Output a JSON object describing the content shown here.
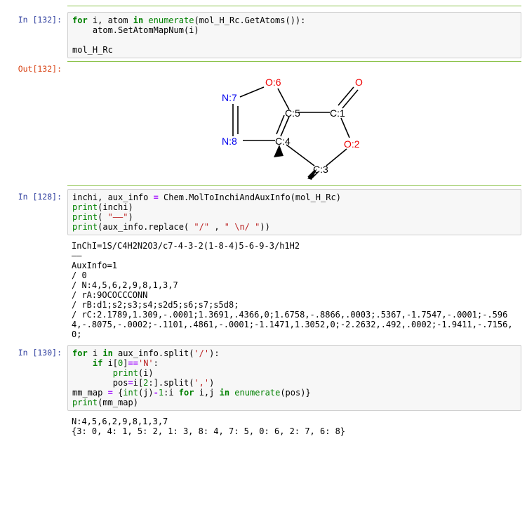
{
  "cells": {
    "c132": {
      "in_prompt": "In  [132]:",
      "out_prompt": "Out[132]:",
      "code_html": "<span class='kw'>for</span> i, atom <span class='kw'>in</span> <span class='builtin'>enumerate</span>(mol_H_Rc.GetAtoms()):\n    atom.SetAtomMapNum(i)\n\nmol_H_Rc",
      "mol": {
        "O6": "O:6",
        "N7": "N:7",
        "N8": "N:8",
        "C5": "C:5",
        "C4": "C:4",
        "C3": "C:3",
        "C1": "C:1",
        "O2": "O:2",
        "Oeq": "O"
      }
    },
    "c128": {
      "in_prompt": "In  [128]:",
      "code_html": "inchi, aux_info <span class='op'>=</span> Chem.MolToInchiAndAuxInfo(mol_H_Rc)\n<span class='builtin'>print</span>(inchi)\n<span class='builtin'>print</span>( <span class='str'>\"——\"</span>)\n<span class='builtin'>print</span>(aux_info.replace( <span class='str'>\"/\"</span> , <span class='str'>\" \\n/ \"</span>))",
      "output": "InChI=1S/C4H2N2O3/c7-4-3-2(1-8-4)5-6-9-3/h1H2\n——\nAuxInfo=1 \n/ 0 \n/ N:4,5,6,2,9,8,1,3,7 \n/ rA:9OCOCCCONN \n/ rB:d1;s2;s3;s4;s2d5;s6;s7;s5d8; \n/ rC:2.1789,1.309,-.0001;1.3691,.4366,0;1.6758,-.8866,.0003;.5367,-1.7547,-.0001;-.5964,-.8075,-.0002;-.1101,.4861,-.0001;-1.1471,1.3052,0;-2.2632,.492,.0002;-1.9411,-.7156,0;"
    },
    "c130": {
      "in_prompt": "In  [130]:",
      "code_html": "<span class='kw'>for</span> i <span class='kw'>in</span> aux_info.split(<span class='str'>'/'</span>):\n    <span class='kw'>if</span> i[<span class='num'>0</span>]<span class='op'>==</span><span class='str'>'N'</span>:\n        <span class='builtin'>print</span>(i)\n        pos<span class='op'>=</span>i[<span class='num'>2</span>:].split(<span class='str'>','</span>)\nmm_map <span class='op'>=</span> {<span class='builtin'>int</span>(j)<span class='op'>-</span><span class='num'>1</span>:i <span class='kw'>for</span> i,j <span class='kw'>in</span> <span class='builtin'>enumerate</span>(pos)}\n<span class='builtin'>print</span>(mm_map)",
      "output": "N:4,5,6,2,9,8,1,3,7\n{3: 0, 4: 1, 5: 2, 1: 3, 8: 4, 7: 5, 0: 6, 2: 7, 6: 8}"
    }
  }
}
